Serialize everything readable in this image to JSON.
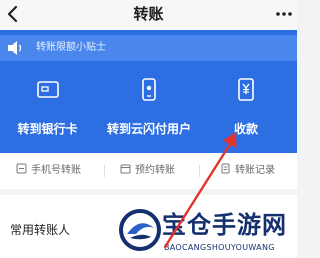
{
  "navbar": {
    "title": "转账",
    "more_icon": "more-dots-icon",
    "back_icon": "chevron-left-icon"
  },
  "notice": {
    "text": "转账限额小贴士",
    "icon": "speaker-icon"
  },
  "actions": [
    {
      "label": "转到银行卡",
      "icon": "bank-card-icon"
    },
    {
      "label": "转到云闪付用户",
      "icon": "phone-user-icon"
    },
    {
      "label": "收款",
      "icon": "yuan-receipt-icon"
    }
  ],
  "subactions": [
    {
      "label": "手机号转账",
      "icon": "phone-transfer-icon"
    },
    {
      "label": "预约转账",
      "icon": "calendar-icon"
    },
    {
      "label": "转账记录",
      "icon": "record-icon"
    }
  ],
  "section": {
    "heading": "常用转账人"
  },
  "watermark": {
    "title": "宝仓手游网",
    "subtitle": "BAOCANGSHOUYOUWANG"
  },
  "colors": {
    "accent": "#2d6fe3",
    "arrow": "#e5322d",
    "watermark": "#15306e"
  }
}
